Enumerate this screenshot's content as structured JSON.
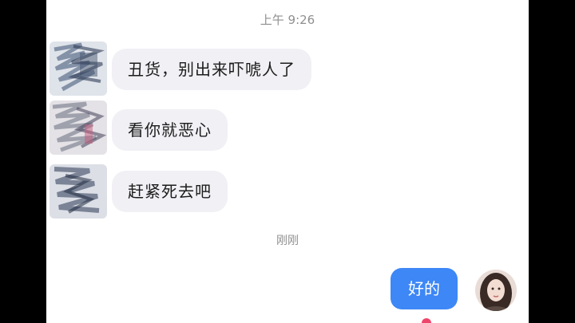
{
  "chat": {
    "timestamp_top": "上午 9:26",
    "timestamp_recent": "刚刚",
    "incoming": [
      "丑货，别出来吓唬人了",
      "看你就恶心",
      "赶紧死去吧"
    ],
    "outgoing": [
      "好的"
    ]
  },
  "colors": {
    "incoming_bubble": "#f1f0f5",
    "outgoing_bubble": "#3d87f6",
    "timestamp": "#8f8f8f",
    "unread_dot": "#f0456a"
  },
  "icons": {
    "sender_avatar": "scribbled-avatar",
    "own_avatar": "portrait-avatar"
  }
}
